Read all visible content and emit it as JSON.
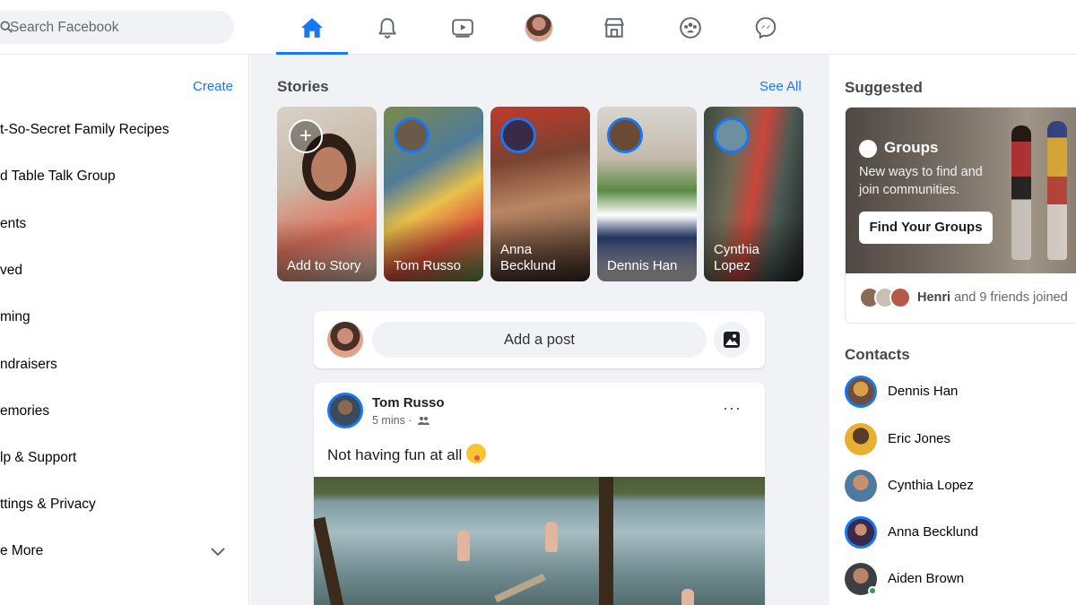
{
  "search": {
    "placeholder": "Search Facebook"
  },
  "nav": {
    "items": [
      "home-icon",
      "notifications-icon",
      "watch-icon",
      "profile-avatar",
      "marketplace-icon",
      "groups-icon",
      "messenger-icon"
    ],
    "active": "home-icon",
    "accent": "#1877f2"
  },
  "sidebar": {
    "create_label": "Create",
    "items": [
      {
        "label": "t-So-Secret Family Recipes"
      },
      {
        "label": "d Table Talk Group"
      },
      {
        "label": "ents"
      },
      {
        "label": "ved"
      },
      {
        "label": "ming"
      },
      {
        "label": "ndraisers"
      },
      {
        "label": "emories"
      },
      {
        "label": "lp & Support"
      },
      {
        "label": "ttings & Privacy"
      },
      {
        "label": "e More"
      }
    ]
  },
  "stories": {
    "title": "Stories",
    "see_all": "See All",
    "items": [
      {
        "label": "Add to Story"
      },
      {
        "label": "Tom Russo"
      },
      {
        "label": "Anna Becklund"
      },
      {
        "label": "Dennis Han"
      },
      {
        "label": "Cynthia Lopez"
      }
    ]
  },
  "composer": {
    "add_post": "Add a post"
  },
  "post": {
    "author": "Tom Russo",
    "time": "5 mins ·",
    "text": "Not having fun at all",
    "more": "···"
  },
  "suggested": {
    "title": "Suggested",
    "groups_title": "Groups",
    "groups_desc": "New ways to find and join communities.",
    "find_button": "Find Your Groups",
    "friend_name": "Henri",
    "friends_text": "and 9 friends joined"
  },
  "contacts": {
    "title": "Contacts",
    "items": [
      {
        "name": "Dennis Han"
      },
      {
        "name": "Eric Jones"
      },
      {
        "name": "Cynthia Lopez"
      },
      {
        "name": "Anna Becklund"
      },
      {
        "name": "Aiden Brown"
      }
    ]
  }
}
